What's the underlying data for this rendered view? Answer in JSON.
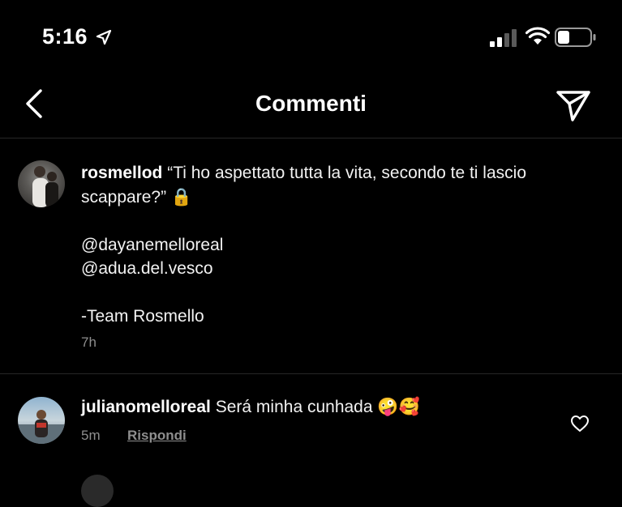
{
  "status_bar": {
    "time": "5:16"
  },
  "header": {
    "title": "Commenti"
  },
  "caption": {
    "username": "rosmellod",
    "text_line_1": "“Ti ho aspettato tutta la vita,  secondo te ti lascio",
    "text_line_2": "scappare?” 🔒",
    "mention_1": "@dayanemelloreal",
    "mention_2": "@adua.del.vesco",
    "signature": "-Team Rosmello",
    "time": "7h"
  },
  "comments": [
    {
      "username": "julianomelloreal",
      "text": "Será minha cunhada 🤪🥰",
      "time": "5m",
      "reply_label": "Rispondi"
    }
  ],
  "colors": {
    "background": "#000000",
    "text": "#ffffff",
    "secondary_text": "#8e8e8e",
    "divider": "#262626"
  },
  "icons": [
    "location-arrow-icon",
    "signal-icon",
    "wifi-icon",
    "battery-icon",
    "back-chevron-icon",
    "send-icon",
    "heart-icon"
  ]
}
